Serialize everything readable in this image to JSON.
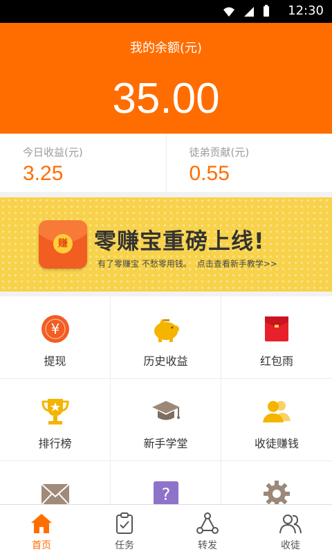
{
  "status_bar": {
    "time": "12:30"
  },
  "header": {
    "title": "我的余额(元)",
    "amount": "35.00"
  },
  "stats": [
    {
      "label": "今日收益(元)",
      "value": "3.25"
    },
    {
      "label": "徒弟贡献(元)",
      "value": "0.55"
    }
  ],
  "banner": {
    "headline": "零赚宝重磅上线!",
    "tagline": "有了零赚宝  不愁零用钱。",
    "link": "点击查看新手教学>>",
    "seal_char": "赚"
  },
  "grid": [
    {
      "label": "提现",
      "icon": "yuan-coin-icon"
    },
    {
      "label": "历史收益",
      "icon": "piggy-bank-icon"
    },
    {
      "label": "红包雨",
      "icon": "red-envelope-icon"
    },
    {
      "label": "排行榜",
      "icon": "trophy-icon"
    },
    {
      "label": "新手学堂",
      "icon": "graduation-cap-icon"
    },
    {
      "label": "收徒赚钱",
      "icon": "users-icon"
    },
    {
      "label": "",
      "icon": "mail-icon"
    },
    {
      "label": "",
      "icon": "help-icon"
    },
    {
      "label": "",
      "icon": "gear-icon"
    }
  ],
  "tabs": [
    {
      "label": "首页",
      "icon": "home-icon",
      "active": true
    },
    {
      "label": "任务",
      "icon": "clipboard-icon",
      "active": false
    },
    {
      "label": "转发",
      "icon": "share-icon",
      "active": false
    },
    {
      "label": "收徒",
      "icon": "users-icon",
      "active": false
    }
  ],
  "colors": {
    "accent": "#ff6d00",
    "banner": "#f7d24a",
    "envelope": "#f25d22"
  }
}
